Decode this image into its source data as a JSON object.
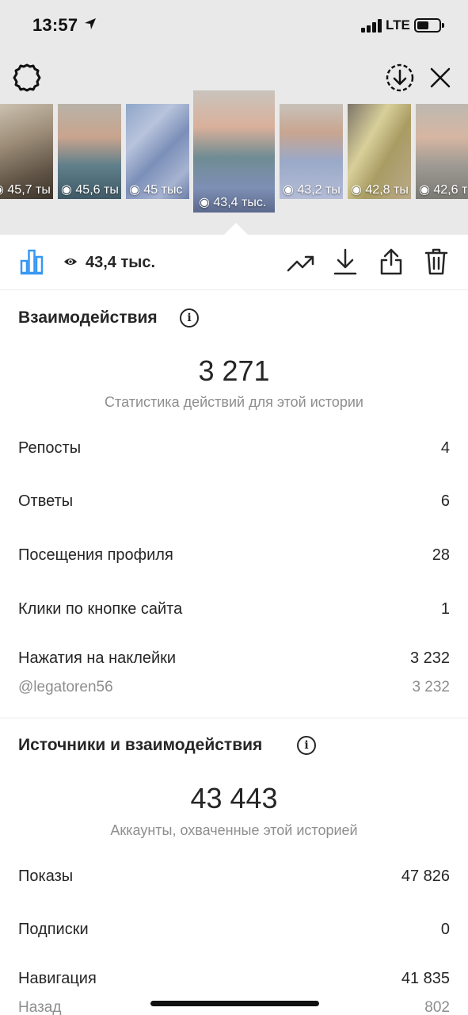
{
  "status_bar": {
    "time": "13:57",
    "network": "LTE"
  },
  "header": {
    "settings_icon": "gear-icon",
    "download_all_icon": "download-circle-icon",
    "close_icon": "close-icon"
  },
  "stories": [
    {
      "views": "45,7 ты"
    },
    {
      "views": "45,6 ты"
    },
    {
      "views": "45 тыс"
    },
    {
      "views": "43,4 тыс.",
      "selected": true
    },
    {
      "views": "43,2 ты"
    },
    {
      "views": "42,8 ты"
    },
    {
      "views": "42,6 т"
    }
  ],
  "toolbar": {
    "views_count": "43,4 тыс.",
    "accent_color": "#3897f0"
  },
  "interactions": {
    "title": "Взаимодействия",
    "total": "3 271",
    "caption": "Статистика действий для этой истории",
    "rows": [
      {
        "label": "Репосты",
        "value": "4"
      },
      {
        "label": "Ответы",
        "value": "6"
      },
      {
        "label": "Посещения профиля",
        "value": "28"
      },
      {
        "label": "Клики по кнопке сайта",
        "value": "1"
      },
      {
        "label": "Нажатия на наклейки",
        "value": "3 232"
      }
    ],
    "sticker_sub": {
      "label": "@legatoren56",
      "value": "3 232"
    }
  },
  "discovery": {
    "title": "Источники и взаимодействия",
    "total": "43 443",
    "caption": "Аккаунты, охваченные этой историей",
    "rows": [
      {
        "label": "Показы",
        "value": "47 826"
      },
      {
        "label": "Подписки",
        "value": "0"
      },
      {
        "label": "Навигация",
        "value": "41 835"
      }
    ],
    "nav_sub": {
      "label": "Назад",
      "value": "802"
    }
  }
}
